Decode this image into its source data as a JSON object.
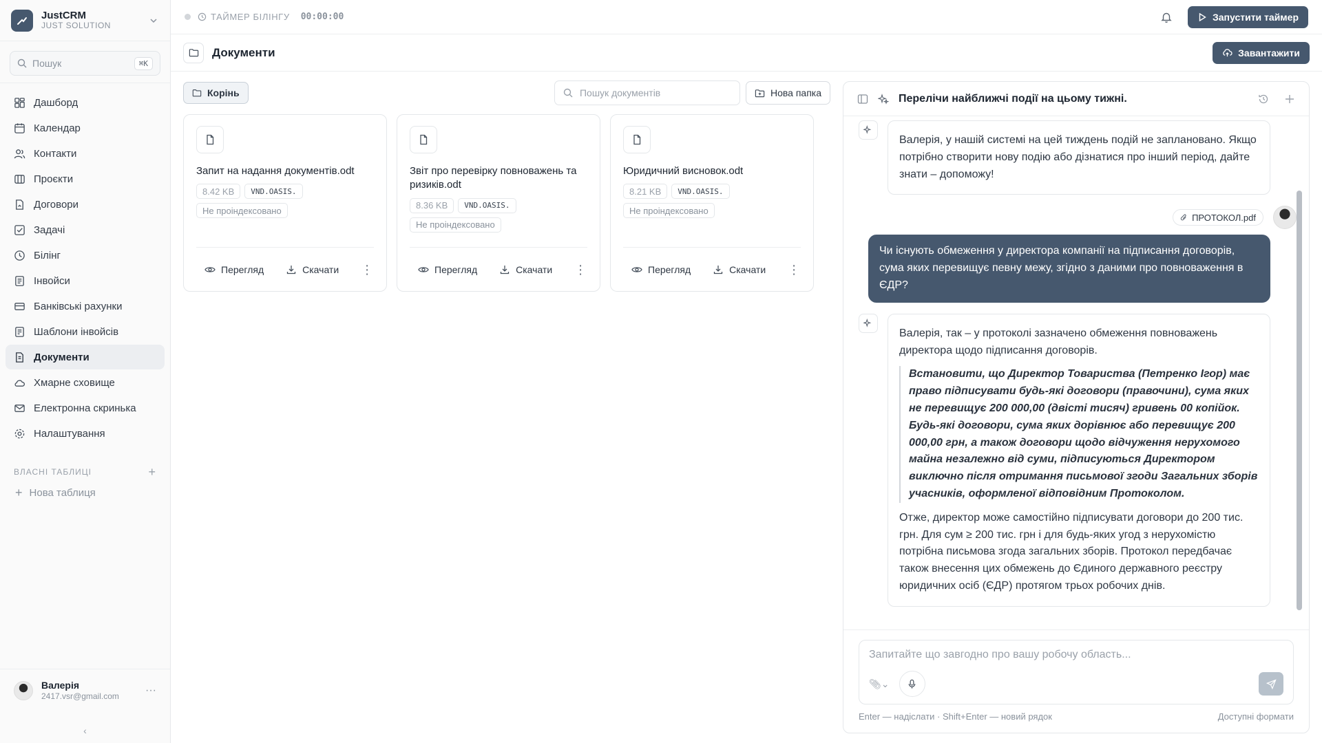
{
  "brand": {
    "name": "JustCRM",
    "subtitle": "JUST SOLUTION"
  },
  "sidebar": {
    "search_placeholder": "Пошук",
    "search_shortcut": "⌘K",
    "items": [
      {
        "label": "Дашборд",
        "icon": "dashboard-icon"
      },
      {
        "label": "Календар",
        "icon": "calendar-icon"
      },
      {
        "label": "Контакти",
        "icon": "users-icon"
      },
      {
        "label": "Проєкти",
        "icon": "projects-icon"
      },
      {
        "label": "Договори",
        "icon": "contract-icon"
      },
      {
        "label": "Задачі",
        "icon": "tasks-icon"
      },
      {
        "label": "Білінг",
        "icon": "clock-icon"
      },
      {
        "label": "Інвойси",
        "icon": "invoice-icon"
      },
      {
        "label": "Банківські рахунки",
        "icon": "bank-icon"
      },
      {
        "label": "Шаблони інвойсів",
        "icon": "template-icon"
      },
      {
        "label": "Документи",
        "icon": "document-icon",
        "active": true
      },
      {
        "label": "Хмарне сховище",
        "icon": "cloud-icon"
      },
      {
        "label": "Електронна скринька",
        "icon": "mail-icon"
      },
      {
        "label": "Налаштування",
        "icon": "settings-icon"
      }
    ],
    "section_title": "ВЛАСНІ ТАБЛИЦІ",
    "new_table": "Нова таблиця",
    "user": {
      "name": "Валерія",
      "email": "2417.vsr@gmail.com"
    }
  },
  "topbar": {
    "timer_label": "ТАЙМЕР БІЛІНГУ",
    "timer_value": "00:00:00",
    "start_timer": "Запустити таймер"
  },
  "page": {
    "title": "Документи",
    "upload": "Завантажити"
  },
  "docs": {
    "root_label": "Корінь",
    "search_placeholder": "Пошук документів",
    "new_folder": "Нова папка",
    "view_label": "Перегляд",
    "download_label": "Скачати",
    "files": [
      {
        "name": "Запит на надання документів.odt",
        "size": "8.42 KB",
        "type": "VND.OASIS.",
        "status": "Не проіндексовано"
      },
      {
        "name": "Звіт про перевірку повноважень та ризиків.odt",
        "size": "8.36 KB",
        "type": "VND.OASIS.",
        "status": "Не проіндексовано"
      },
      {
        "name": "Юридичний висновок.odt",
        "size": "8.21 KB",
        "type": "VND.OASIS.",
        "status": "Не проіндексовано"
      }
    ]
  },
  "chat": {
    "title": "Перелічи найближчі події на цьому тижні.",
    "msg1": "Валерія, у нашій системі на цей тиждень подій не заплановано. Якщо потрібно створити нову подію або дізнатися про інший період, дайте знати – допоможу!",
    "attachment": "ПРОТОКОЛ.pdf",
    "user_msg": "Чи існують обмеження у директора компанії на підписання договорів, сума яких перевищує певну межу, згідно з даними про повноваження в ЄДР?",
    "reply_intro": "Валерія, так – у протоколі зазначено обмеження повноважень директора щодо підписання договорів.",
    "reply_quote": "Встановити, що Директор Товариства (Петренко Ігор) має право підписувати будь-які договори (правочини), сума яких не перевищує 200 000,00 (двісті тисяч) гривень 00 копійок. Будь-які договори, сума яких дорівнює або перевищує 200 000,00 грн, а також договори щодо відчуження нерухомого майна незалежно від суми, підписуються Директором виключно після отримання письмової згоди Загальних зборів учасників, оформленої відповідним Протоколом.",
    "reply_outro": "Отже, директор може самостійно підписувати договори до 200 тис. грн. Для сум ≥ 200 тис. грн і для будь-яких угод з нерухомістю потрібна письмова згода загальних зборів. Протокол передбачає також внесення цих обмежень до Єдиного державного реєстру юридичних осіб (ЄДР) протягом трьох робочих днів.",
    "input_placeholder": "Запитайте що завгодно про вашу робочу область...",
    "hint_left": "Enter — надіслати · Shift+Enter — новий рядок",
    "hint_right": "Доступні формати"
  },
  "colors": {
    "accent": "#46586e",
    "active_bg": "#eceef1",
    "border": "#e4e7ea"
  }
}
